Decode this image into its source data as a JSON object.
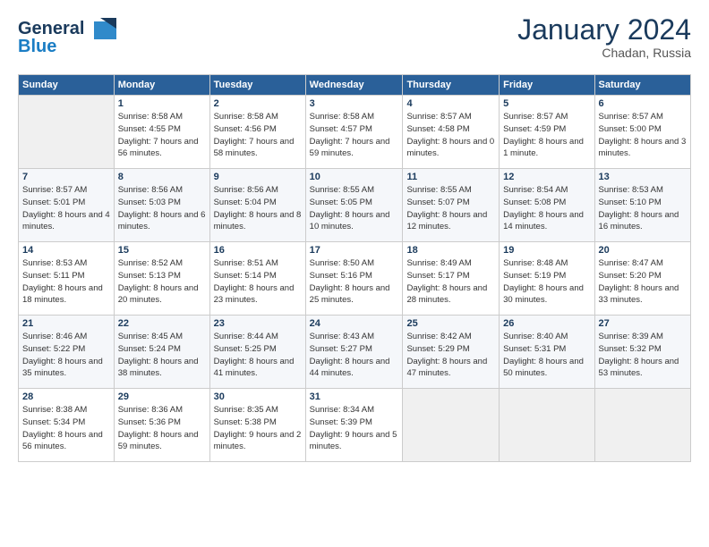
{
  "header": {
    "logo_general": "General",
    "logo_blue": "Blue",
    "month": "January 2024",
    "location": "Chadan, Russia"
  },
  "weekdays": [
    "Sunday",
    "Monday",
    "Tuesday",
    "Wednesday",
    "Thursday",
    "Friday",
    "Saturday"
  ],
  "weeks": [
    [
      {
        "day": "",
        "empty": true
      },
      {
        "day": "1",
        "sunrise": "8:58 AM",
        "sunset": "4:55 PM",
        "daylight": "7 hours and 56 minutes."
      },
      {
        "day": "2",
        "sunrise": "8:58 AM",
        "sunset": "4:56 PM",
        "daylight": "7 hours and 58 minutes."
      },
      {
        "day": "3",
        "sunrise": "8:58 AM",
        "sunset": "4:57 PM",
        "daylight": "7 hours and 59 minutes."
      },
      {
        "day": "4",
        "sunrise": "8:57 AM",
        "sunset": "4:58 PM",
        "daylight": "8 hours and 0 minutes."
      },
      {
        "day": "5",
        "sunrise": "8:57 AM",
        "sunset": "4:59 PM",
        "daylight": "8 hours and 1 minute."
      },
      {
        "day": "6",
        "sunrise": "8:57 AM",
        "sunset": "5:00 PM",
        "daylight": "8 hours and 3 minutes."
      }
    ],
    [
      {
        "day": "7",
        "sunrise": "8:57 AM",
        "sunset": "5:01 PM",
        "daylight": "8 hours and 4 minutes."
      },
      {
        "day": "8",
        "sunrise": "8:56 AM",
        "sunset": "5:03 PM",
        "daylight": "8 hours and 6 minutes."
      },
      {
        "day": "9",
        "sunrise": "8:56 AM",
        "sunset": "5:04 PM",
        "daylight": "8 hours and 8 minutes."
      },
      {
        "day": "10",
        "sunrise": "8:55 AM",
        "sunset": "5:05 PM",
        "daylight": "8 hours and 10 minutes."
      },
      {
        "day": "11",
        "sunrise": "8:55 AM",
        "sunset": "5:07 PM",
        "daylight": "8 hours and 12 minutes."
      },
      {
        "day": "12",
        "sunrise": "8:54 AM",
        "sunset": "5:08 PM",
        "daylight": "8 hours and 14 minutes."
      },
      {
        "day": "13",
        "sunrise": "8:53 AM",
        "sunset": "5:10 PM",
        "daylight": "8 hours and 16 minutes."
      }
    ],
    [
      {
        "day": "14",
        "sunrise": "8:53 AM",
        "sunset": "5:11 PM",
        "daylight": "8 hours and 18 minutes."
      },
      {
        "day": "15",
        "sunrise": "8:52 AM",
        "sunset": "5:13 PM",
        "daylight": "8 hours and 20 minutes."
      },
      {
        "day": "16",
        "sunrise": "8:51 AM",
        "sunset": "5:14 PM",
        "daylight": "8 hours and 23 minutes."
      },
      {
        "day": "17",
        "sunrise": "8:50 AM",
        "sunset": "5:16 PM",
        "daylight": "8 hours and 25 minutes."
      },
      {
        "day": "18",
        "sunrise": "8:49 AM",
        "sunset": "5:17 PM",
        "daylight": "8 hours and 28 minutes."
      },
      {
        "day": "19",
        "sunrise": "8:48 AM",
        "sunset": "5:19 PM",
        "daylight": "8 hours and 30 minutes."
      },
      {
        "day": "20",
        "sunrise": "8:47 AM",
        "sunset": "5:20 PM",
        "daylight": "8 hours and 33 minutes."
      }
    ],
    [
      {
        "day": "21",
        "sunrise": "8:46 AM",
        "sunset": "5:22 PM",
        "daylight": "8 hours and 35 minutes."
      },
      {
        "day": "22",
        "sunrise": "8:45 AM",
        "sunset": "5:24 PM",
        "daylight": "8 hours and 38 minutes."
      },
      {
        "day": "23",
        "sunrise": "8:44 AM",
        "sunset": "5:25 PM",
        "daylight": "8 hours and 41 minutes."
      },
      {
        "day": "24",
        "sunrise": "8:43 AM",
        "sunset": "5:27 PM",
        "daylight": "8 hours and 44 minutes."
      },
      {
        "day": "25",
        "sunrise": "8:42 AM",
        "sunset": "5:29 PM",
        "daylight": "8 hours and 47 minutes."
      },
      {
        "day": "26",
        "sunrise": "8:40 AM",
        "sunset": "5:31 PM",
        "daylight": "8 hours and 50 minutes."
      },
      {
        "day": "27",
        "sunrise": "8:39 AM",
        "sunset": "5:32 PM",
        "daylight": "8 hours and 53 minutes."
      }
    ],
    [
      {
        "day": "28",
        "sunrise": "8:38 AM",
        "sunset": "5:34 PM",
        "daylight": "8 hours and 56 minutes."
      },
      {
        "day": "29",
        "sunrise": "8:36 AM",
        "sunset": "5:36 PM",
        "daylight": "8 hours and 59 minutes."
      },
      {
        "day": "30",
        "sunrise": "8:35 AM",
        "sunset": "5:38 PM",
        "daylight": "9 hours and 2 minutes."
      },
      {
        "day": "31",
        "sunrise": "8:34 AM",
        "sunset": "5:39 PM",
        "daylight": "9 hours and 5 minutes."
      },
      {
        "day": "",
        "empty": true
      },
      {
        "day": "",
        "empty": true
      },
      {
        "day": "",
        "empty": true
      }
    ]
  ]
}
